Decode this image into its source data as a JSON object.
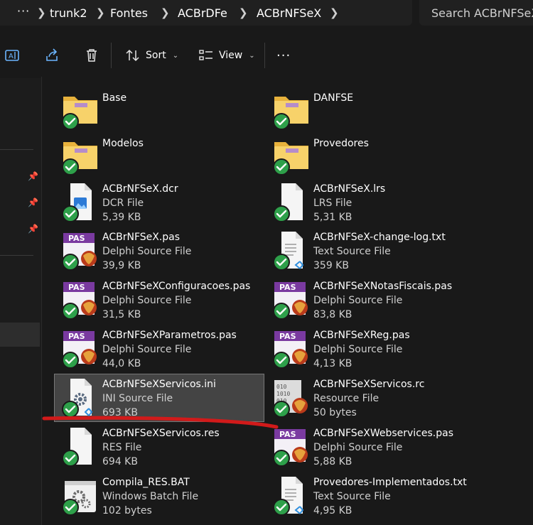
{
  "address": {
    "more": "···",
    "crumbs": [
      "trunk2",
      "Fontes",
      "ACBrDFe",
      "ACBrNFSeX"
    ]
  },
  "search": {
    "placeholder": "Search ACBrNFSeX"
  },
  "toolbar": {
    "sort_label": "Sort",
    "view_label": "View",
    "more_label": "···"
  },
  "items": [
    {
      "name": "Base",
      "type": "",
      "size": "",
      "icon": "folder-icon"
    },
    {
      "name": "DANFSE",
      "type": "",
      "size": "",
      "icon": "folder-icon"
    },
    {
      "name": "Modelos",
      "type": "",
      "size": "",
      "icon": "folder-icon"
    },
    {
      "name": "Provedores",
      "type": "",
      "size": "",
      "icon": "folder-icon"
    },
    {
      "name": "ACBrNFSeX.dcr",
      "type": "DCR File",
      "size": "5,39 KB",
      "icon": "image-file-icon"
    },
    {
      "name": "ACBrNFSeX.lrs",
      "type": "LRS File",
      "size": "5,31 KB",
      "icon": "blank-file-icon"
    },
    {
      "name": "ACBrNFSeX.pas",
      "type": "Delphi Source File",
      "size": "39,9 KB",
      "icon": "pas-file-icon"
    },
    {
      "name": "ACBrNFSeX-change-log.txt",
      "type": "Text Source File",
      "size": "359 KB",
      "icon": "text-file-icon"
    },
    {
      "name": "ACBrNFSeXConfiguracoes.pas",
      "type": "Delphi Source File",
      "size": "31,5 KB",
      "icon": "pas-file-icon"
    },
    {
      "name": "ACBrNFSeXNotasFiscais.pas",
      "type": "Delphi Source File",
      "size": "83,8 KB",
      "icon": "pas-file-icon"
    },
    {
      "name": "ACBrNFSeXParametros.pas",
      "type": "Delphi Source File",
      "size": "44,0 KB",
      "icon": "pas-file-icon"
    },
    {
      "name": "ACBrNFSeXReg.pas",
      "type": "Delphi Source File",
      "size": "4,13 KB",
      "icon": "pas-file-icon"
    },
    {
      "name": "ACBrNFSeXServicos.ini",
      "type": "INI Source File",
      "size": "693 KB",
      "icon": "ini-file-icon"
    },
    {
      "name": "ACBrNFSeXServicos.rc",
      "type": "Resource File",
      "size": "50 bytes",
      "icon": "resource-file-icon"
    },
    {
      "name": "ACBrNFSeXServicos.res",
      "type": "RES File",
      "size": "694 KB",
      "icon": "blank-file-icon"
    },
    {
      "name": "ACBrNFSeXWebservices.pas",
      "type": "Delphi Source File",
      "size": "5,88 KB",
      "icon": "pas-file-icon"
    },
    {
      "name": "Compila_RES.BAT",
      "type": "Windows Batch File",
      "size": "102 bytes",
      "icon": "batch-file-icon"
    },
    {
      "name": "Provedores-Implementados.txt",
      "type": "Text Source File",
      "size": "4,95 KB",
      "icon": "text-file-icon"
    }
  ],
  "colors": {
    "background": "#191919",
    "selection": "#444444",
    "sync_check": "#2ea04a",
    "folder": "#f2c94c",
    "annotation": "#d11a1a",
    "pas_badge": "#7a3aa0"
  }
}
